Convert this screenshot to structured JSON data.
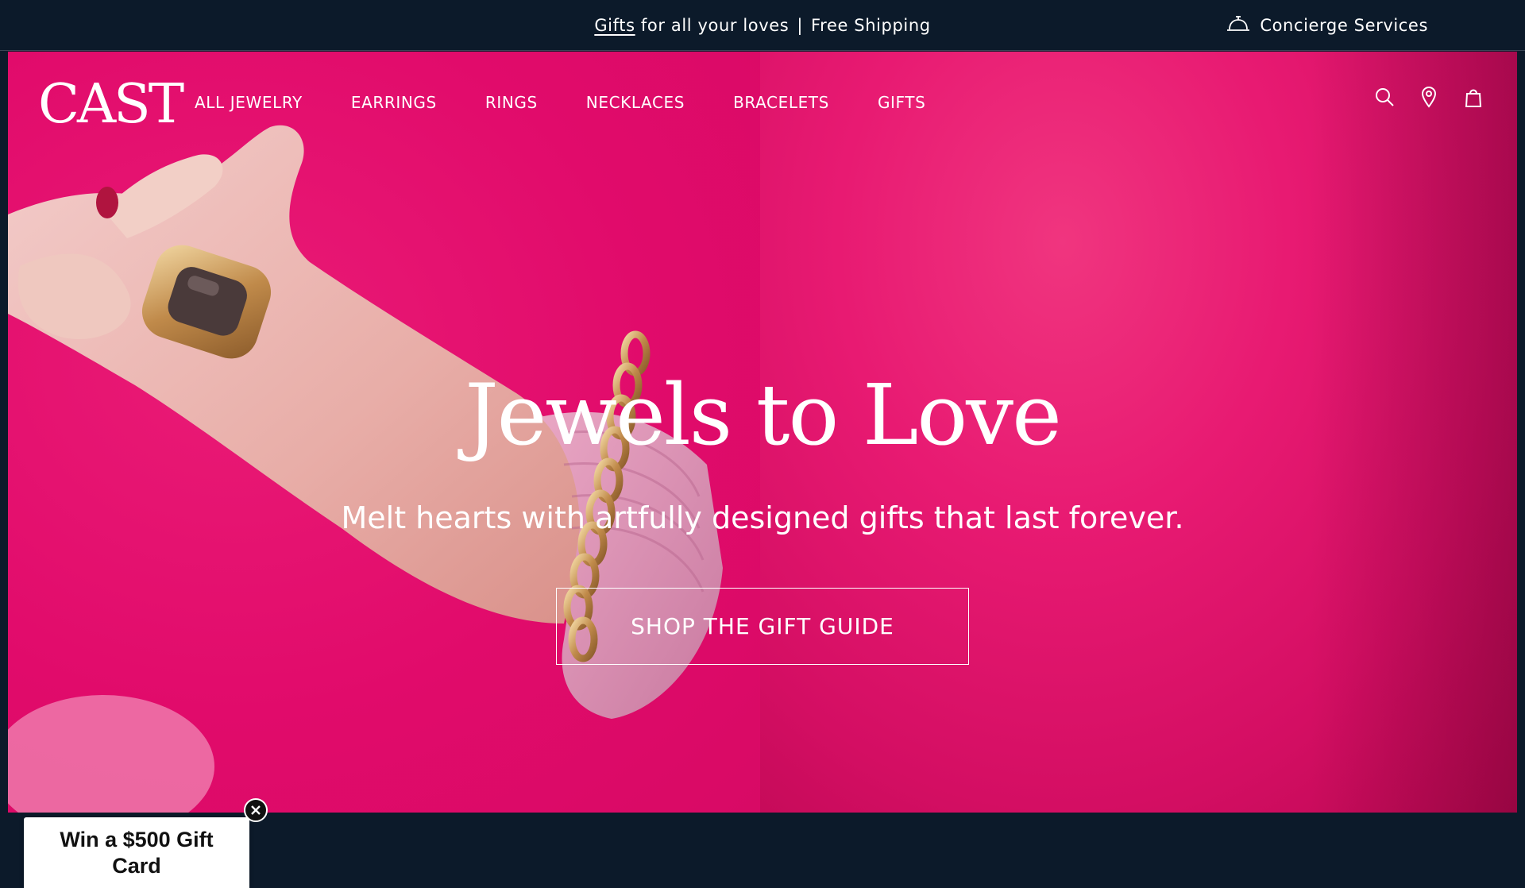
{
  "announcement": {
    "gifts_link": "Gifts",
    "text_middle": " for all your loves",
    "separator": "|",
    "shipping": "Free Shipping"
  },
  "concierge": {
    "icon": "service-bell-icon",
    "label": "Concierge Services"
  },
  "header": {
    "logo": "CAST",
    "nav": [
      {
        "label": "ALL JEWELRY"
      },
      {
        "label": "EARRINGS"
      },
      {
        "label": "RINGS"
      },
      {
        "label": "NECKLACES"
      },
      {
        "label": "BRACELETS"
      },
      {
        "label": "GIFTS"
      }
    ],
    "icons": [
      "search-icon",
      "location-pin-icon",
      "shopping-bag-icon"
    ]
  },
  "hero": {
    "title": "Jewels to Love",
    "subtitle": "Melt hearts with artfully designed gifts that last forever.",
    "cta": "SHOP THE GIFT GUIDE"
  },
  "promo": {
    "text": "Win a $500 Gift Card"
  },
  "colors": {
    "navy": "#0c1a2a",
    "magenta": "#e10b6b",
    "white": "#ffffff"
  }
}
